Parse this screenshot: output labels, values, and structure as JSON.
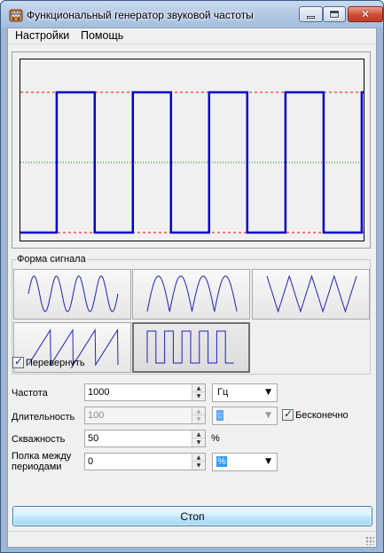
{
  "window": {
    "title": "Функциональный генератор звуковой частоты",
    "minimize_glyph": "",
    "close_glyph": "✕"
  },
  "menu": {
    "items": [
      "Настройки",
      "Помощь"
    ]
  },
  "oscilloscope": {
    "waveform": "square",
    "signal_color": "#0000cc",
    "level_line_color": "#ff0000",
    "center_line_color": "#008000",
    "high_level": 1,
    "low_level": -1,
    "visible_periods": 4.5,
    "starts_with": "low"
  },
  "waveform_group": {
    "title": "Форма сигнала",
    "buttons": [
      {
        "name": "sine",
        "icon": "sine-wave-icon",
        "selected": false
      },
      {
        "name": "rectified-sine",
        "icon": "rectified-sine-wave-icon",
        "selected": false
      },
      {
        "name": "triangle",
        "icon": "triangle-wave-icon",
        "selected": false
      },
      {
        "name": "sawtooth",
        "icon": "sawtooth-wave-icon",
        "selected": false
      },
      {
        "name": "square",
        "icon": "square-wave-icon",
        "selected": true
      }
    ]
  },
  "invert": {
    "label": "Перевернуть",
    "checked": true
  },
  "settings": {
    "frequency": {
      "label": "Частота",
      "value": "1000",
      "unit": "Гц"
    },
    "duration": {
      "label": "Длительность",
      "value": "100",
      "unit": "с",
      "disabled": true
    },
    "infinite": {
      "label": "Бесконечно",
      "checked": true
    },
    "duty": {
      "label": "Скважность",
      "value": "50",
      "unit": "%"
    },
    "gap": {
      "label_line1": "Полка между",
      "label_line2": "периодами",
      "value": "0",
      "unit": "%"
    }
  },
  "stop_button": {
    "label": "Стоп"
  },
  "colors": {
    "titlebar": "#b9cfe9",
    "close_button": "#c94a35",
    "stop_button_border": "#3c7fb1",
    "selection": "#3399ff"
  }
}
